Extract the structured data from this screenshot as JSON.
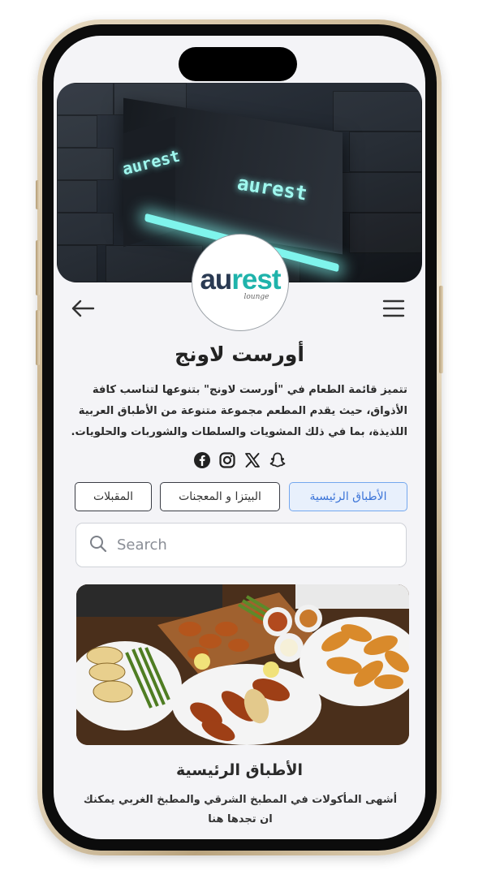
{
  "restaurant": {
    "name": "أورست لاونج",
    "description": "تتميز قائمة الطعام في \"أورست لاونج\" بتنوعها لتناسب كافة الأذواق، حيث يقدم المطعم مجموعة متنوعة من الأطباق العربية اللذيذة، بما في ذلك المشويات والسلطات والشوربات والحلويات.",
    "logo_primary": "au",
    "logo_accent": "rest",
    "logo_sub": "lounge",
    "cover_sign_text": "aurest"
  },
  "nav": {
    "back_icon": "arrow-left-icon",
    "menu_icon": "hamburger-menu-icon"
  },
  "socials": [
    {
      "name": "snapchat",
      "icon": "snapchat-icon"
    },
    {
      "name": "x",
      "icon": "x-icon"
    },
    {
      "name": "instagram",
      "icon": "instagram-icon"
    },
    {
      "name": "facebook",
      "icon": "facebook-icon"
    }
  ],
  "tabs": [
    {
      "label": "الأطباق الرئيسية",
      "active": true
    },
    {
      "label": "البيتزا و المعجنات",
      "active": false
    },
    {
      "label": "المقبلات",
      "active": false
    }
  ],
  "search": {
    "placeholder": "Search",
    "value": ""
  },
  "section": {
    "title": "الأطباق  الرئيسية",
    "description": "أشهى المأكولات في المطبخ الشرقي والمطبخ الغربي يمكنك ان تجدها هنا"
  },
  "colors": {
    "accent_blue": "#3b74d8",
    "brand_teal": "#1fb3ab",
    "brand_navy": "#2a3a52",
    "screen_bg": "#f4f4f7"
  }
}
